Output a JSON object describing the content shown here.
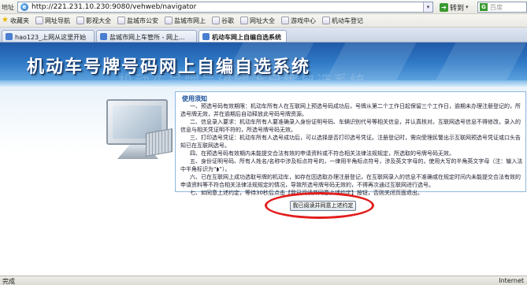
{
  "browser": {
    "address_label": "地址",
    "url": "http://221.231.10.230:9080/vehweb/navigator",
    "go_label": "转到",
    "search_placeholder": "百度"
  },
  "favorites": [
    {
      "label": "收藏夹"
    },
    {
      "label": "网址导航"
    },
    {
      "label": "影视大全"
    },
    {
      "label": "盐城市公安"
    },
    {
      "label": "盐城市网上"
    },
    {
      "label": "谷歌"
    },
    {
      "label": "网址大全"
    },
    {
      "label": "游戏中心"
    },
    {
      "label": "机动车登记"
    }
  ],
  "tabs": [
    {
      "label": "hao123_上网从这里开始"
    },
    {
      "label": "盐城市网上车管所 - 网上..."
    },
    {
      "label": "机动车网上自编自选系统"
    }
  ],
  "banner": {
    "title": "机动车号牌号码网上自编自选系统",
    "ghost_title": "机动车号牌号码网上自编自选系统"
  },
  "notice": {
    "header": "使用须知",
    "paragraphs": [
      "一、预选号码有效期限：机动车所有人在互联网上预选号码成功后，号牌从第二个工作日起保留三个工作日，逾期未办理注册登记的，所选号牌无效，并在逾期后自动释放此号码号牌资源。",
      "二、信息录入要求：机动车所有人要准确录入身份证明号码、车辆识别代号等相关信息，并认真核对。互联网选号信息不得修改，录入的信息与相关凭证明不符的，所选号牌号码无效。",
      "三、打印选号凭证：机动车所有人选号成功后，可以选择是否打印选号凭证。注册登记时，需向受理民警出示互联网预选号凭证或口头告知已在互联网选号。",
      "四、在预选号码有效期内未能提交合法有效的申请资料或不符合相关法律法规规定，所选取的号牌号码无效。",
      "五、身份证明号码、所有人姓名/名称中涉及标点符号的，一律用半角标点符号，涉及英文字母的，使用大写的半角英文字母（注：输入法中半角标识为“◗”）。",
      "六、已在互联网上成功选取号牌的机动车，如存在因选取办理注册登记，在互联网录入的信息不准确或在规定时间内未能提交合法有效的申请资料等不符合相关法律法规规定的情况，导致所选号牌号码无效的，不得再次通过互联网进行选号。",
      "七、如同意上述约定，等待30秒后点击【我已阅读并同意上述约定】按钮，否则关闭页面退出。"
    ]
  },
  "agree_button": "我已阅读并同意上述约定",
  "status": {
    "text": "完成",
    "zone": "Internet"
  },
  "colors": {
    "banner_dark": "#1f5aa8",
    "banner_light": "#6cb0e6",
    "annotation_red": "#e21d1d",
    "notice_border": "#8eb8dd"
  }
}
